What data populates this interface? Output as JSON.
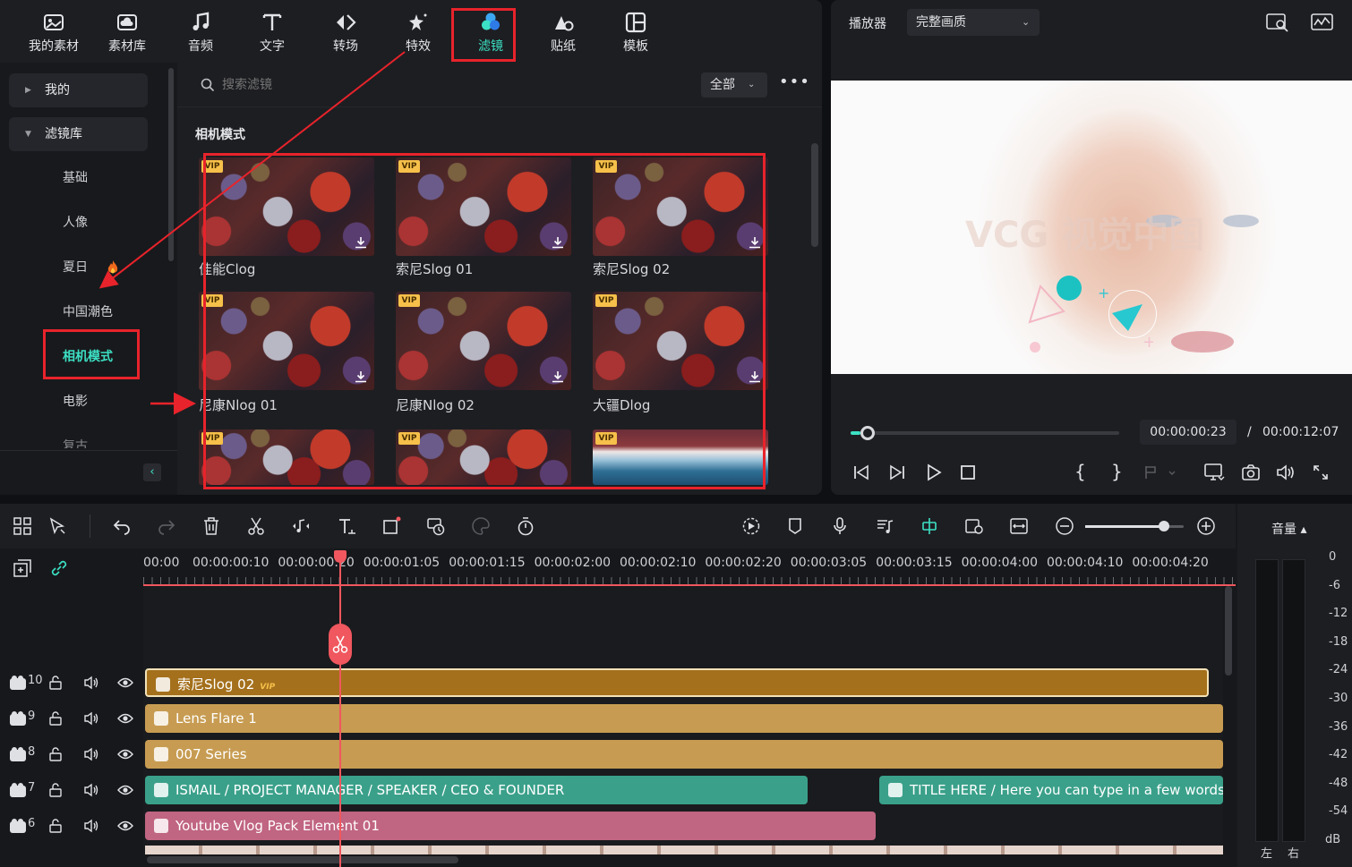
{
  "toolbar": {
    "tabs": [
      {
        "label": "我的素材",
        "icon": "my-media-icon"
      },
      {
        "label": "素材库",
        "icon": "stock-library-icon"
      },
      {
        "label": "音频",
        "icon": "music-note-icon"
      },
      {
        "label": "文字",
        "icon": "text-icon"
      },
      {
        "label": "转场",
        "icon": "transition-icon"
      },
      {
        "label": "特效",
        "icon": "effects-icon"
      },
      {
        "label": "滤镜",
        "icon": "filter-icon",
        "active": true
      },
      {
        "label": "贴纸",
        "icon": "sticker-icon"
      },
      {
        "label": "模板",
        "icon": "template-icon"
      }
    ]
  },
  "sidebar": {
    "groups": [
      {
        "label": "我的",
        "expanded": false
      },
      {
        "label": "滤镜库",
        "expanded": true
      }
    ],
    "items": [
      {
        "label": "基础"
      },
      {
        "label": "人像"
      },
      {
        "label": "夏日",
        "hot": true
      },
      {
        "label": "中国潮色"
      },
      {
        "label": "相机模式",
        "active": true
      },
      {
        "label": "电影"
      },
      {
        "label": "复古"
      }
    ]
  },
  "search": {
    "placeholder": "搜索滤镜",
    "filter_value": "全部"
  },
  "content": {
    "section_title": "相机模式",
    "vip_badge": "VIP",
    "items": [
      {
        "label": "佳能Clog",
        "vip": true
      },
      {
        "label": "索尼Slog 01",
        "vip": true
      },
      {
        "label": "索尼Slog 02",
        "vip": true
      },
      {
        "label": "尼康Nlog 01",
        "vip": true
      },
      {
        "label": "尼康Nlog 02",
        "vip": true
      },
      {
        "label": "大疆Dlog",
        "vip": true
      },
      {
        "label": "",
        "vip": true
      },
      {
        "label": "",
        "vip": true
      },
      {
        "label": "",
        "vip": true
      }
    ]
  },
  "player": {
    "label": "播放器",
    "quality": "完整画质",
    "watermark": "VCG 视觉中国",
    "current_time": "00:00:00:23",
    "separator": "/",
    "total_time": "00:00:12:07",
    "progress": 0.035
  },
  "timeline": {
    "ruler_labels": [
      "00:00",
      "00:00:00:10",
      "00:00:00:20",
      "00:00:01:05",
      "00:00:01:15",
      "00:00:02:00",
      "00:00:02:10",
      "00:00:02:20",
      "00:00:03:05",
      "00:00:03:15",
      "00:00:04:00",
      "00:00:04:10",
      "00:00:04:20"
    ],
    "tracks": [
      {
        "number": "10",
        "clips": [
          {
            "label": "索尼Slog 02",
            "vip": "VIP"
          }
        ]
      },
      {
        "number": "9",
        "clips": [
          {
            "label": "Lens Flare 1"
          }
        ]
      },
      {
        "number": "8",
        "clips": [
          {
            "label": "007 Series"
          }
        ]
      },
      {
        "number": "7",
        "clips": [
          {
            "label": "ISMAIL / PROJECT MANAGER / SPEAKER / CEO & FOUNDER"
          },
          {
            "label": "TITLE HERE / Here you can type in a few words to"
          }
        ]
      },
      {
        "number": "6",
        "clips": [
          {
            "label": "Youtube Vlog Pack Element 01"
          }
        ]
      }
    ],
    "zoom_level": 0.8
  },
  "meter": {
    "title": "音量 ▴",
    "db_labels": [
      "0",
      "-6",
      "-12",
      "-18",
      "-24",
      "-30",
      "-36",
      "-42",
      "-48",
      "-54",
      "dB"
    ],
    "left_label": "左",
    "right_label": "右"
  },
  "colors": {
    "accent": "#3ce0c4",
    "annotation_red": "#e8232b",
    "clip_filter": "#a4701c",
    "clip_effect": "#c79c52",
    "clip_title": "#3aa08a",
    "clip_element": "#c06582",
    "playhead": "#f0575e"
  }
}
